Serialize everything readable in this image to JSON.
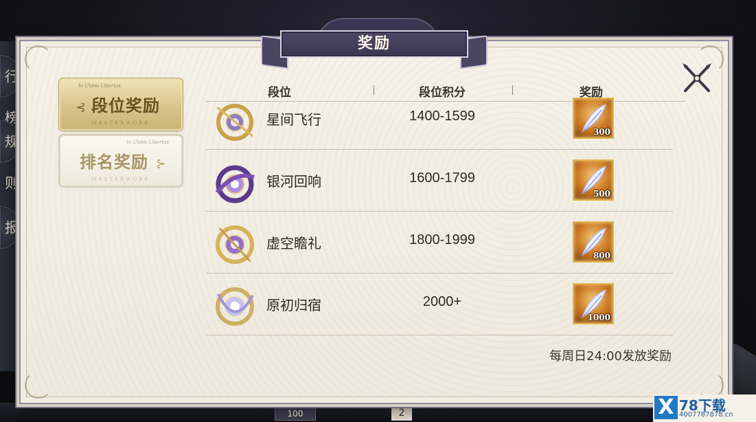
{
  "dialog": {
    "title": "奖励",
    "close_icon": "close-icon"
  },
  "background_side_tabs": [
    "行榜",
    "规则",
    "报"
  ],
  "background_bottom": {
    "badge": "100",
    "number": "2"
  },
  "tabs": [
    {
      "label": "段位奖励",
      "small_text": "In Ubbis Libertas",
      "sub_text": "MASTERWORK",
      "active": true
    },
    {
      "label": "排名奖励",
      "small_text": "In Ubbis Libertas",
      "sub_text": "MASTERWORK",
      "active": false
    }
  ],
  "table": {
    "columns": [
      "段位",
      "段位积分",
      "奖励"
    ],
    "rows": [
      {
        "name": "星间飞行",
        "score": "1400-1599",
        "reward_qty": "300",
        "icon": "rank-emblem-icon"
      },
      {
        "name": "银河回响",
        "score": "1600-1799",
        "reward_qty": "500",
        "icon": "rank-emblem-icon"
      },
      {
        "name": "虚空瞻礼",
        "score": "1800-1999",
        "reward_qty": "800",
        "icon": "rank-emblem-icon"
      },
      {
        "name": "原初归宿",
        "score": "2000+",
        "reward_qty": "1000",
        "icon": "rank-emblem-icon"
      }
    ]
  },
  "footer_note": "每周日24:00发放奖励",
  "watermark": {
    "mark": "X",
    "text": "78下载",
    "url": "4007787878.cn"
  },
  "colors": {
    "panel": "#f2ede3",
    "title_bar": "#3b3750",
    "tab_active": "#d9c48c",
    "reward_frame": "#e2b448"
  }
}
